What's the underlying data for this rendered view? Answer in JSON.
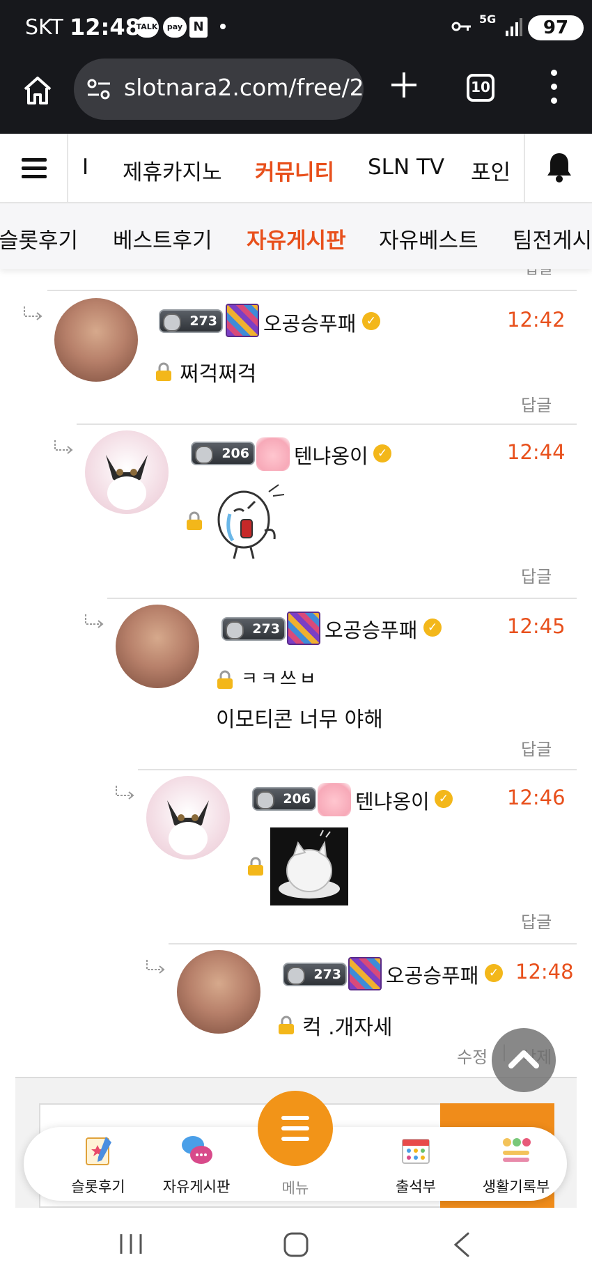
{
  "status_bar": {
    "carrier": "SKT",
    "time": "12:48",
    "notification_icons": [
      "TALK",
      "pay",
      "N"
    ],
    "network": "5G",
    "battery": "97"
  },
  "browser": {
    "url": "slotnara2.com/free/2",
    "tab_count": "10"
  },
  "site_nav": {
    "items": [
      {
        "label": "I",
        "active": false
      },
      {
        "label": "제휴카지노",
        "active": false
      },
      {
        "label": "커뮤니티",
        "active": true
      },
      {
        "label": "SLN TV",
        "active": false
      },
      {
        "label": "포인",
        "active": false
      }
    ]
  },
  "sub_nav": {
    "items": [
      {
        "label": "슬롯후기",
        "active": false
      },
      {
        "label": "베스트후기",
        "active": false
      },
      {
        "label": "자유게시판",
        "active": true
      },
      {
        "label": "자유베스트",
        "active": false
      },
      {
        "label": "팀전게시판",
        "active": false
      }
    ]
  },
  "comments": [
    {
      "nickname": "오공승푸패",
      "level": "273",
      "time": "12:42",
      "text": "쩌걱쩌걱",
      "action": "답글"
    },
    {
      "nickname": "텐냐옹이",
      "level": "206",
      "time": "12:44",
      "text": "",
      "sticker": "crying-character-sticker",
      "action": "답글"
    },
    {
      "nickname": "오공승푸패",
      "level": "273",
      "time": "12:45",
      "text": "ㅋㅋ쓰ㅂ",
      "text2": "이모티콘 너무 야해",
      "action": "답글"
    },
    {
      "nickname": "텐냐옹이",
      "level": "206",
      "time": "12:46",
      "text": "",
      "sticker": "white-cat-sticker",
      "action": "답글"
    },
    {
      "nickname": "오공승푸패",
      "level": "273",
      "time": "12:48",
      "text": "컥 .개자세",
      "edit": "수정",
      "delete": "삭제"
    }
  ],
  "partial_reply_above": "답글",
  "bottom_dock": {
    "items": [
      "슬롯후기",
      "자유게시판",
      "출석부",
      "생활기록부"
    ],
    "menu_label": "메뉴"
  },
  "colors": {
    "accent": "#e8501c",
    "menu_orange": "#f29418",
    "status_bar": "#17181c"
  }
}
